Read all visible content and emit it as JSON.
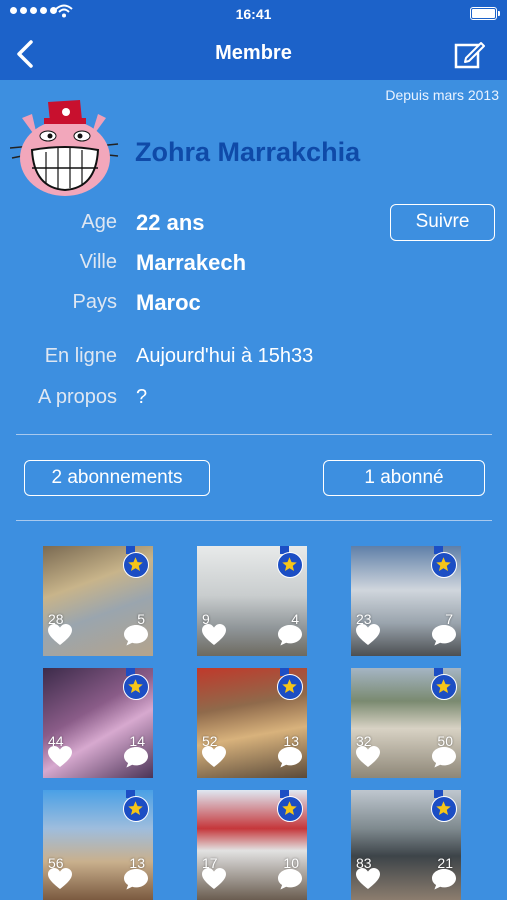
{
  "status": {
    "time": "16:41"
  },
  "nav": {
    "title": "Membre"
  },
  "profile": {
    "since": "Depuis mars 2013",
    "name": "Zohra Marrakchia",
    "follow_label": "Suivre",
    "fields": [
      {
        "label": "Age",
        "value": "22 ans"
      },
      {
        "label": "Ville",
        "value": "Marrakech"
      },
      {
        "label": "Pays",
        "value": "Maroc"
      },
      {
        "label": "En ligne",
        "value": "Aujourd'hui à 15h33"
      },
      {
        "label": "A propos",
        "value": "?"
      }
    ]
  },
  "social": {
    "subscriptions_label": "2 abonnements",
    "followers_label": "1 abonné"
  },
  "photos": [
    {
      "likes": "28",
      "comments": "5",
      "theme": "building"
    },
    {
      "likes": "9",
      "comments": "4",
      "theme": "bus"
    },
    {
      "likes": "23",
      "comments": "7",
      "theme": "car"
    },
    {
      "likes": "44",
      "comments": "14",
      "theme": "shoe"
    },
    {
      "likes": "52",
      "comments": "13",
      "theme": "bread"
    },
    {
      "likes": "32",
      "comments": "50",
      "theme": "trunk"
    },
    {
      "likes": "56",
      "comments": "13",
      "theme": "palm"
    },
    {
      "likes": "17",
      "comments": "10",
      "theme": "shop"
    },
    {
      "likes": "83",
      "comments": "21",
      "theme": "traffic"
    }
  ],
  "colors": {
    "bar": "#1c62c9",
    "background": "#3d8fe0",
    "name": "#0f4aa8",
    "badge": "#1c4ec4",
    "star": "#f5c518"
  },
  "icons": {
    "back": "chevron-left-icon",
    "edit": "compose-icon",
    "like": "heart-icon",
    "comment": "speech-bubble-icon",
    "featured": "star-icon"
  }
}
